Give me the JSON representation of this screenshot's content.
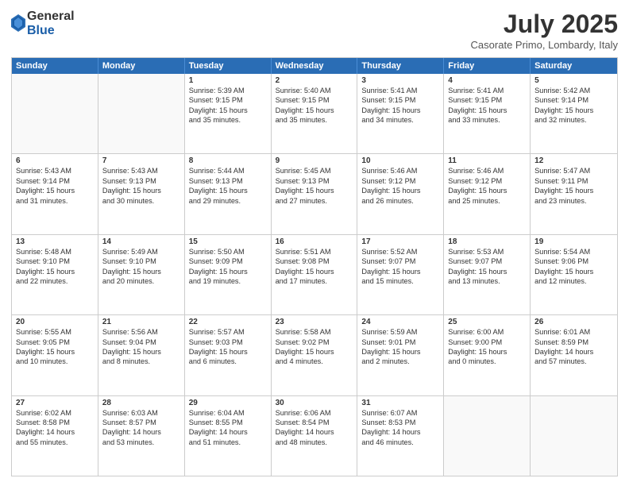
{
  "header": {
    "logo_general": "General",
    "logo_blue": "Blue",
    "month": "July 2025",
    "location": "Casorate Primo, Lombardy, Italy"
  },
  "days_of_week": [
    "Sunday",
    "Monday",
    "Tuesday",
    "Wednesday",
    "Thursday",
    "Friday",
    "Saturday"
  ],
  "rows": [
    [
      {
        "day": "",
        "empty": true
      },
      {
        "day": "",
        "empty": true
      },
      {
        "day": "1",
        "lines": [
          "Sunrise: 5:39 AM",
          "Sunset: 9:15 PM",
          "Daylight: 15 hours",
          "and 35 minutes."
        ]
      },
      {
        "day": "2",
        "lines": [
          "Sunrise: 5:40 AM",
          "Sunset: 9:15 PM",
          "Daylight: 15 hours",
          "and 35 minutes."
        ]
      },
      {
        "day": "3",
        "lines": [
          "Sunrise: 5:41 AM",
          "Sunset: 9:15 PM",
          "Daylight: 15 hours",
          "and 34 minutes."
        ]
      },
      {
        "day": "4",
        "lines": [
          "Sunrise: 5:41 AM",
          "Sunset: 9:15 PM",
          "Daylight: 15 hours",
          "and 33 minutes."
        ]
      },
      {
        "day": "5",
        "lines": [
          "Sunrise: 5:42 AM",
          "Sunset: 9:14 PM",
          "Daylight: 15 hours",
          "and 32 minutes."
        ]
      }
    ],
    [
      {
        "day": "6",
        "lines": [
          "Sunrise: 5:43 AM",
          "Sunset: 9:14 PM",
          "Daylight: 15 hours",
          "and 31 minutes."
        ]
      },
      {
        "day": "7",
        "lines": [
          "Sunrise: 5:43 AM",
          "Sunset: 9:13 PM",
          "Daylight: 15 hours",
          "and 30 minutes."
        ]
      },
      {
        "day": "8",
        "lines": [
          "Sunrise: 5:44 AM",
          "Sunset: 9:13 PM",
          "Daylight: 15 hours",
          "and 29 minutes."
        ]
      },
      {
        "day": "9",
        "lines": [
          "Sunrise: 5:45 AM",
          "Sunset: 9:13 PM",
          "Daylight: 15 hours",
          "and 27 minutes."
        ]
      },
      {
        "day": "10",
        "lines": [
          "Sunrise: 5:46 AM",
          "Sunset: 9:12 PM",
          "Daylight: 15 hours",
          "and 26 minutes."
        ]
      },
      {
        "day": "11",
        "lines": [
          "Sunrise: 5:46 AM",
          "Sunset: 9:12 PM",
          "Daylight: 15 hours",
          "and 25 minutes."
        ]
      },
      {
        "day": "12",
        "lines": [
          "Sunrise: 5:47 AM",
          "Sunset: 9:11 PM",
          "Daylight: 15 hours",
          "and 23 minutes."
        ]
      }
    ],
    [
      {
        "day": "13",
        "lines": [
          "Sunrise: 5:48 AM",
          "Sunset: 9:10 PM",
          "Daylight: 15 hours",
          "and 22 minutes."
        ]
      },
      {
        "day": "14",
        "lines": [
          "Sunrise: 5:49 AM",
          "Sunset: 9:10 PM",
          "Daylight: 15 hours",
          "and 20 minutes."
        ]
      },
      {
        "day": "15",
        "lines": [
          "Sunrise: 5:50 AM",
          "Sunset: 9:09 PM",
          "Daylight: 15 hours",
          "and 19 minutes."
        ]
      },
      {
        "day": "16",
        "lines": [
          "Sunrise: 5:51 AM",
          "Sunset: 9:08 PM",
          "Daylight: 15 hours",
          "and 17 minutes."
        ]
      },
      {
        "day": "17",
        "lines": [
          "Sunrise: 5:52 AM",
          "Sunset: 9:07 PM",
          "Daylight: 15 hours",
          "and 15 minutes."
        ]
      },
      {
        "day": "18",
        "lines": [
          "Sunrise: 5:53 AM",
          "Sunset: 9:07 PM",
          "Daylight: 15 hours",
          "and 13 minutes."
        ]
      },
      {
        "day": "19",
        "lines": [
          "Sunrise: 5:54 AM",
          "Sunset: 9:06 PM",
          "Daylight: 15 hours",
          "and 12 minutes."
        ]
      }
    ],
    [
      {
        "day": "20",
        "lines": [
          "Sunrise: 5:55 AM",
          "Sunset: 9:05 PM",
          "Daylight: 15 hours",
          "and 10 minutes."
        ]
      },
      {
        "day": "21",
        "lines": [
          "Sunrise: 5:56 AM",
          "Sunset: 9:04 PM",
          "Daylight: 15 hours",
          "and 8 minutes."
        ]
      },
      {
        "day": "22",
        "lines": [
          "Sunrise: 5:57 AM",
          "Sunset: 9:03 PM",
          "Daylight: 15 hours",
          "and 6 minutes."
        ]
      },
      {
        "day": "23",
        "lines": [
          "Sunrise: 5:58 AM",
          "Sunset: 9:02 PM",
          "Daylight: 15 hours",
          "and 4 minutes."
        ]
      },
      {
        "day": "24",
        "lines": [
          "Sunrise: 5:59 AM",
          "Sunset: 9:01 PM",
          "Daylight: 15 hours",
          "and 2 minutes."
        ]
      },
      {
        "day": "25",
        "lines": [
          "Sunrise: 6:00 AM",
          "Sunset: 9:00 PM",
          "Daylight: 15 hours",
          "and 0 minutes."
        ]
      },
      {
        "day": "26",
        "lines": [
          "Sunrise: 6:01 AM",
          "Sunset: 8:59 PM",
          "Daylight: 14 hours",
          "and 57 minutes."
        ]
      }
    ],
    [
      {
        "day": "27",
        "lines": [
          "Sunrise: 6:02 AM",
          "Sunset: 8:58 PM",
          "Daylight: 14 hours",
          "and 55 minutes."
        ]
      },
      {
        "day": "28",
        "lines": [
          "Sunrise: 6:03 AM",
          "Sunset: 8:57 PM",
          "Daylight: 14 hours",
          "and 53 minutes."
        ]
      },
      {
        "day": "29",
        "lines": [
          "Sunrise: 6:04 AM",
          "Sunset: 8:55 PM",
          "Daylight: 14 hours",
          "and 51 minutes."
        ]
      },
      {
        "day": "30",
        "lines": [
          "Sunrise: 6:06 AM",
          "Sunset: 8:54 PM",
          "Daylight: 14 hours",
          "and 48 minutes."
        ]
      },
      {
        "day": "31",
        "lines": [
          "Sunrise: 6:07 AM",
          "Sunset: 8:53 PM",
          "Daylight: 14 hours",
          "and 46 minutes."
        ]
      },
      {
        "day": "",
        "empty": true
      },
      {
        "day": "",
        "empty": true
      }
    ]
  ]
}
